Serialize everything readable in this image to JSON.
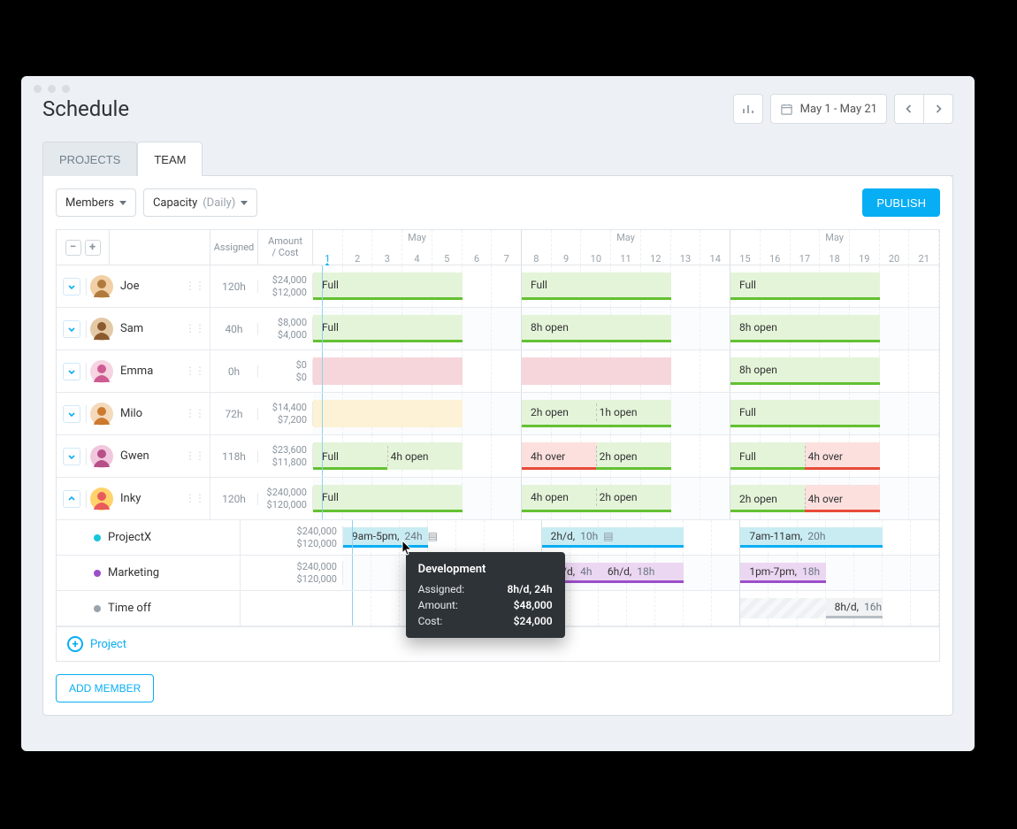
{
  "header": {
    "title": "Schedule",
    "date_range": "May 1 - May 21",
    "tabs": {
      "projects": "PROJECTS",
      "team": "TEAM"
    }
  },
  "toolbar": {
    "members_label": "Members",
    "capacity_label": "Capacity",
    "capacity_mode": "(Daily)",
    "publish_label": "PUBLISH"
  },
  "columns": {
    "assigned": "Assigned",
    "amount": "Amount",
    "cost": "/ Cost"
  },
  "calendar": {
    "month_label": "May",
    "days": [
      1,
      2,
      3,
      4,
      5,
      6,
      7,
      8,
      9,
      10,
      11,
      12,
      13,
      14,
      15,
      16,
      17,
      18,
      19,
      20,
      21
    ],
    "today_index": 0,
    "week_breaks": [
      6,
      13
    ]
  },
  "members": [
    {
      "name": "Joe",
      "assigned": "120h",
      "amount": "$24,000",
      "cost": "$12,000",
      "avatar_bg": "#f2cfa5",
      "avatar_fg": "#b07a3e",
      "weeks": [
        [
          {
            "t": "Full",
            "cls": "green",
            "span": 5
          }
        ],
        [
          {
            "t": "Full",
            "cls": "green",
            "span": 5
          }
        ],
        [
          {
            "t": "Full",
            "cls": "green",
            "span": 5
          }
        ]
      ]
    },
    {
      "name": "Sam",
      "assigned": "40h",
      "amount": "$8,000",
      "cost": "$4,000",
      "avatar_bg": "#e4c9a6",
      "avatar_fg": "#8b5a2e",
      "weeks": [
        [
          {
            "t": "Full",
            "cls": "green",
            "span": 5
          }
        ],
        [
          {
            "t": "8h open",
            "cls": "green",
            "span": 5
          }
        ],
        [
          {
            "t": "8h open",
            "cls": "green",
            "span": 5
          }
        ]
      ]
    },
    {
      "name": "Emma",
      "assigned": "0h",
      "amount": "$0",
      "cost": "$0",
      "avatar_bg": "#f6d4e1",
      "avatar_fg": "#cf5b93",
      "weeks": [
        [
          {
            "t": "",
            "cls": "pink",
            "span": 5
          }
        ],
        [
          {
            "t": "",
            "cls": "pink",
            "span": 5
          }
        ],
        [
          {
            "t": "8h open",
            "cls": "green",
            "span": 5
          }
        ]
      ]
    },
    {
      "name": "Milo",
      "assigned": "72h",
      "amount": "$14,400",
      "cost": "$7,200",
      "avatar_bg": "#f4d9bb",
      "avatar_fg": "#cc7a2e",
      "weeks": [
        [
          {
            "t": "",
            "cls": "cream",
            "span": 5
          }
        ],
        [
          {
            "t": "2h open",
            "t2": "1h open",
            "cls": "green",
            "span": 5,
            "split": true
          }
        ],
        [
          {
            "t": "Full",
            "cls": "green",
            "span": 5
          }
        ]
      ]
    },
    {
      "name": "Gwen",
      "assigned": "118h",
      "amount": "$23,600",
      "cost": "$11,800",
      "avatar_bg": "#f1c7de",
      "avatar_fg": "#b74f88",
      "weeks": [
        [
          {
            "t": "Full",
            "t2": "4h open",
            "cls": "green",
            "half_border": true,
            "span": 5,
            "split": true
          }
        ],
        [
          {
            "t": "4h over",
            "t2": "2h open",
            "cls": "mix-gr",
            "span": 5,
            "split": true,
            "first_border": "#e84b3a",
            "second_border": "#63c132"
          }
        ],
        [
          {
            "t": "Full",
            "t2": "4h over",
            "cls": "mix-gr-rev",
            "span": 5,
            "split": true,
            "first_border": "#63c132",
            "second_border": "#e84b3a"
          }
        ]
      ]
    },
    {
      "name": "Inky",
      "assigned": "120h",
      "amount": "$240,000",
      "cost": "$120,000",
      "avatar_bg": "#ffd36b",
      "avatar_fg": "#e95b5b",
      "expanded": true,
      "weeks": [
        [
          {
            "t": "Full",
            "cls": "green",
            "span": 5
          }
        ],
        [
          {
            "t": "4h open",
            "t2": "2h open",
            "cls": "green",
            "span": 5,
            "split": true
          }
        ],
        [
          {
            "t": "2h open",
            "t2": "4h over",
            "cls": "mix-gr-rev2",
            "span": 5,
            "split": true,
            "first_border": "#63c132",
            "second_border": "#e84b3a"
          }
        ]
      ]
    }
  ],
  "subrows": [
    {
      "name": "ProjectX",
      "dot": "#18c6d9",
      "amount": "$240,000",
      "cost": "$120,000",
      "weeks": [
        [
          {
            "t": "9am-5pm,",
            "t_extra": "24h",
            "cls": "cyan",
            "span": 3,
            "note": true
          }
        ],
        [
          {
            "t": "2h/d,",
            "t_extra": "10h",
            "cls": "cyan",
            "span": 5,
            "note": true
          }
        ],
        [
          {
            "t": "7am-11am,",
            "t_extra": "20h",
            "cls": "cyan",
            "span": 5
          }
        ]
      ]
    },
    {
      "name": "Marketing",
      "dot": "#9b4fc8",
      "amount": "$240,000",
      "cost": "$120,000",
      "weeks": [
        [],
        [
          {
            "t": "2h/d,",
            "t_extra": "4h",
            "cls": "purple",
            "span": 2,
            "offset": 0
          },
          {
            "t": "6h/d,",
            "t_extra": "18h",
            "cls": "purple",
            "span": 3,
            "offset": 2
          }
        ],
        [
          {
            "t": "1pm-7pm,",
            "t_extra": "18h",
            "cls": "purple",
            "span": 3
          }
        ]
      ]
    },
    {
      "name": "Time off",
      "dot": "#9aa4ad",
      "amount": "",
      "cost": "",
      "weeks": [
        [],
        [],
        [
          {
            "t": "",
            "cls": "hatched",
            "span": 5,
            "offset": 0
          },
          {
            "t": "8h/d,",
            "t_extra": "16h",
            "cls": "grey",
            "span": 2,
            "offset": 3,
            "layer": 1
          }
        ]
      ]
    }
  ],
  "add_project_label": "Project",
  "add_member_label": "ADD MEMBER",
  "tooltip": {
    "title": "Development",
    "rows": [
      {
        "label": "Assigned:",
        "value": "8h/d, 24h"
      },
      {
        "label": "Amount:",
        "value": "$48,000"
      },
      {
        "label": "Cost:",
        "value": "$24,000"
      }
    ]
  }
}
